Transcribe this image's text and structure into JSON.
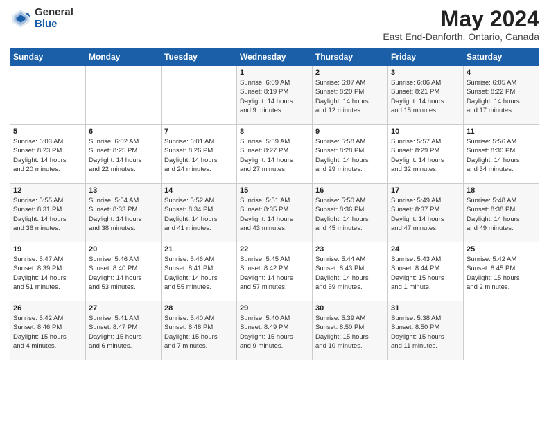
{
  "header": {
    "logo_general": "General",
    "logo_blue": "Blue",
    "title": "May 2024",
    "subtitle": "East End-Danforth, Ontario, Canada"
  },
  "days_of_week": [
    "Sunday",
    "Monday",
    "Tuesday",
    "Wednesday",
    "Thursday",
    "Friday",
    "Saturday"
  ],
  "weeks": [
    [
      {
        "day": "",
        "content": ""
      },
      {
        "day": "",
        "content": ""
      },
      {
        "day": "",
        "content": ""
      },
      {
        "day": "1",
        "content": "Sunrise: 6:09 AM\nSunset: 8:19 PM\nDaylight: 14 hours\nand 9 minutes."
      },
      {
        "day": "2",
        "content": "Sunrise: 6:07 AM\nSunset: 8:20 PM\nDaylight: 14 hours\nand 12 minutes."
      },
      {
        "day": "3",
        "content": "Sunrise: 6:06 AM\nSunset: 8:21 PM\nDaylight: 14 hours\nand 15 minutes."
      },
      {
        "day": "4",
        "content": "Sunrise: 6:05 AM\nSunset: 8:22 PM\nDaylight: 14 hours\nand 17 minutes."
      }
    ],
    [
      {
        "day": "5",
        "content": "Sunrise: 6:03 AM\nSunset: 8:23 PM\nDaylight: 14 hours\nand 20 minutes."
      },
      {
        "day": "6",
        "content": "Sunrise: 6:02 AM\nSunset: 8:25 PM\nDaylight: 14 hours\nand 22 minutes."
      },
      {
        "day": "7",
        "content": "Sunrise: 6:01 AM\nSunset: 8:26 PM\nDaylight: 14 hours\nand 24 minutes."
      },
      {
        "day": "8",
        "content": "Sunrise: 5:59 AM\nSunset: 8:27 PM\nDaylight: 14 hours\nand 27 minutes."
      },
      {
        "day": "9",
        "content": "Sunrise: 5:58 AM\nSunset: 8:28 PM\nDaylight: 14 hours\nand 29 minutes."
      },
      {
        "day": "10",
        "content": "Sunrise: 5:57 AM\nSunset: 8:29 PM\nDaylight: 14 hours\nand 32 minutes."
      },
      {
        "day": "11",
        "content": "Sunrise: 5:56 AM\nSunset: 8:30 PM\nDaylight: 14 hours\nand 34 minutes."
      }
    ],
    [
      {
        "day": "12",
        "content": "Sunrise: 5:55 AM\nSunset: 8:31 PM\nDaylight: 14 hours\nand 36 minutes."
      },
      {
        "day": "13",
        "content": "Sunrise: 5:54 AM\nSunset: 8:33 PM\nDaylight: 14 hours\nand 38 minutes."
      },
      {
        "day": "14",
        "content": "Sunrise: 5:52 AM\nSunset: 8:34 PM\nDaylight: 14 hours\nand 41 minutes."
      },
      {
        "day": "15",
        "content": "Sunrise: 5:51 AM\nSunset: 8:35 PM\nDaylight: 14 hours\nand 43 minutes."
      },
      {
        "day": "16",
        "content": "Sunrise: 5:50 AM\nSunset: 8:36 PM\nDaylight: 14 hours\nand 45 minutes."
      },
      {
        "day": "17",
        "content": "Sunrise: 5:49 AM\nSunset: 8:37 PM\nDaylight: 14 hours\nand 47 minutes."
      },
      {
        "day": "18",
        "content": "Sunrise: 5:48 AM\nSunset: 8:38 PM\nDaylight: 14 hours\nand 49 minutes."
      }
    ],
    [
      {
        "day": "19",
        "content": "Sunrise: 5:47 AM\nSunset: 8:39 PM\nDaylight: 14 hours\nand 51 minutes."
      },
      {
        "day": "20",
        "content": "Sunrise: 5:46 AM\nSunset: 8:40 PM\nDaylight: 14 hours\nand 53 minutes."
      },
      {
        "day": "21",
        "content": "Sunrise: 5:46 AM\nSunset: 8:41 PM\nDaylight: 14 hours\nand 55 minutes."
      },
      {
        "day": "22",
        "content": "Sunrise: 5:45 AM\nSunset: 8:42 PM\nDaylight: 14 hours\nand 57 minutes."
      },
      {
        "day": "23",
        "content": "Sunrise: 5:44 AM\nSunset: 8:43 PM\nDaylight: 14 hours\nand 59 minutes."
      },
      {
        "day": "24",
        "content": "Sunrise: 5:43 AM\nSunset: 8:44 PM\nDaylight: 15 hours\nand 1 minute."
      },
      {
        "day": "25",
        "content": "Sunrise: 5:42 AM\nSunset: 8:45 PM\nDaylight: 15 hours\nand 2 minutes."
      }
    ],
    [
      {
        "day": "26",
        "content": "Sunrise: 5:42 AM\nSunset: 8:46 PM\nDaylight: 15 hours\nand 4 minutes."
      },
      {
        "day": "27",
        "content": "Sunrise: 5:41 AM\nSunset: 8:47 PM\nDaylight: 15 hours\nand 6 minutes."
      },
      {
        "day": "28",
        "content": "Sunrise: 5:40 AM\nSunset: 8:48 PM\nDaylight: 15 hours\nand 7 minutes."
      },
      {
        "day": "29",
        "content": "Sunrise: 5:40 AM\nSunset: 8:49 PM\nDaylight: 15 hours\nand 9 minutes."
      },
      {
        "day": "30",
        "content": "Sunrise: 5:39 AM\nSunset: 8:50 PM\nDaylight: 15 hours\nand 10 minutes."
      },
      {
        "day": "31",
        "content": "Sunrise: 5:38 AM\nSunset: 8:50 PM\nDaylight: 15 hours\nand 11 minutes."
      },
      {
        "day": "",
        "content": ""
      }
    ]
  ]
}
